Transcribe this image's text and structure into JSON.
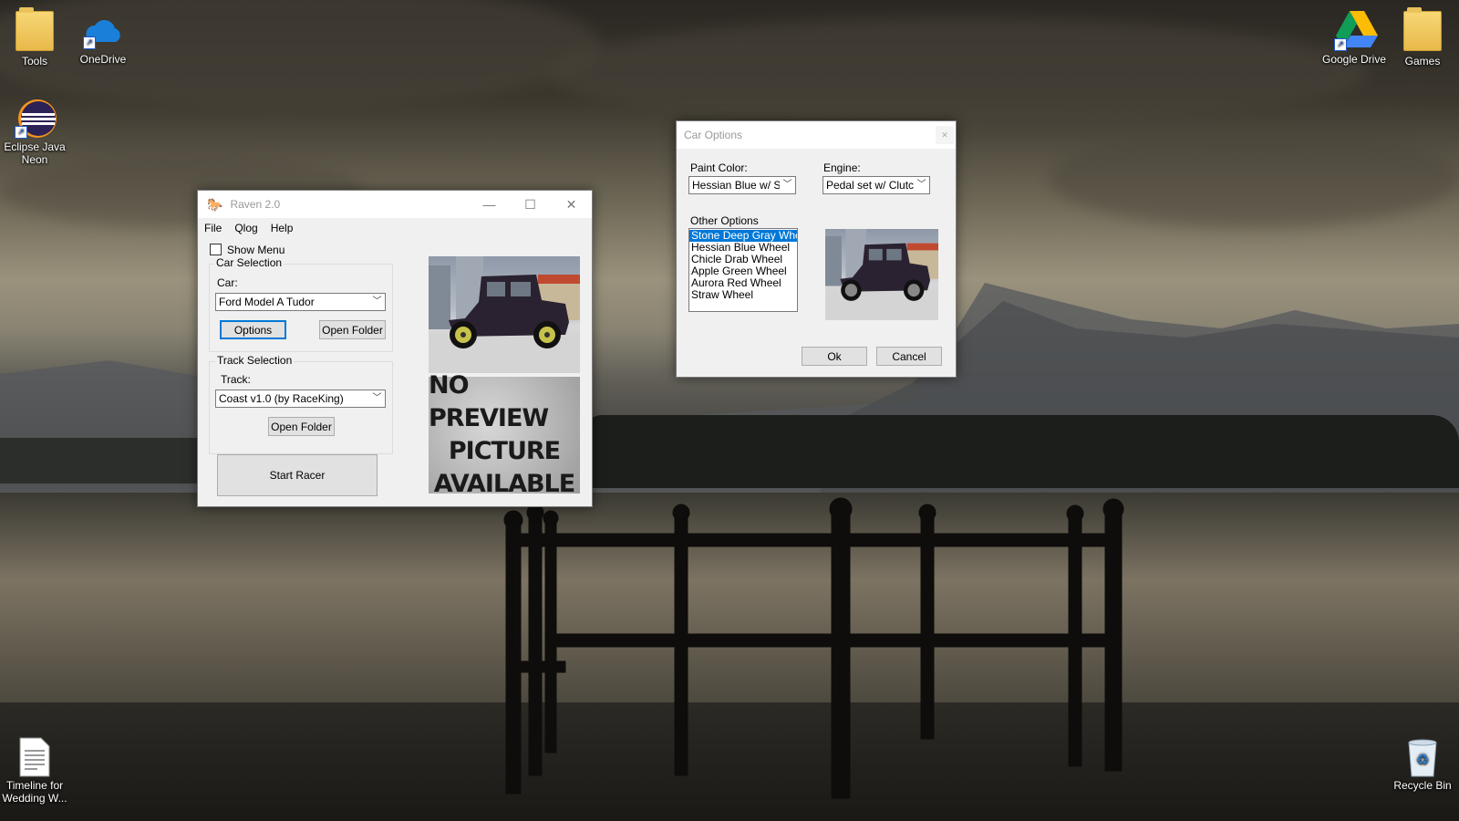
{
  "desktop": {
    "icons": [
      {
        "label": "Tools",
        "icon": "folder-icon"
      },
      {
        "label": "OneDrive",
        "icon": "onedrive-cloud-icon"
      },
      {
        "label": "Eclipse Java Neon",
        "icon": "eclipse-icon"
      },
      {
        "label": "Google Drive",
        "icon": "google-drive-icon"
      },
      {
        "label": "Games",
        "icon": "folder-icon"
      },
      {
        "label": "Timeline for Wedding W...",
        "icon": "document-icon"
      },
      {
        "label": "Recycle Bin",
        "icon": "recycle-bin-icon"
      }
    ]
  },
  "raven": {
    "title": "Raven 2.0",
    "menu": [
      "File",
      "Qlog",
      "Help"
    ],
    "show_menu_label": "Show Menu",
    "show_menu_checked": false,
    "car_selection": {
      "title": "Car Selection",
      "car_label": "Car:",
      "car_value": "Ford Model A Tudor",
      "options_label": "Options",
      "open_folder_label": "Open Folder"
    },
    "track_selection": {
      "title": "Track Selection",
      "track_label": "Track:",
      "track_value": "Coast v1.0 (by RaceKing)",
      "open_folder_label": "Open Folder"
    },
    "start_label": "Start Racer",
    "no_preview": [
      "NO PREVIEW",
      "PICTURE",
      "AVAILABLE"
    ]
  },
  "car_options": {
    "title": "Car Options",
    "paint_label": "Paint Color:",
    "paint_value": "Hessian Blue w/ Stone",
    "engine_label": "Engine:",
    "engine_value": "Pedal set w/ Clutch",
    "other_label": "Other Options",
    "other_items": [
      "Stone Deep Gray Wheel",
      "Hessian Blue Wheel",
      "Chicle Drab Wheel",
      "Apple Green Wheel",
      "Aurora Red Wheel",
      "Straw Wheel"
    ],
    "selected_index": 0,
    "ok_label": "Ok",
    "cancel_label": "Cancel"
  },
  "colors": {
    "accent": "#0078d7",
    "car_body": "#2a2230"
  }
}
